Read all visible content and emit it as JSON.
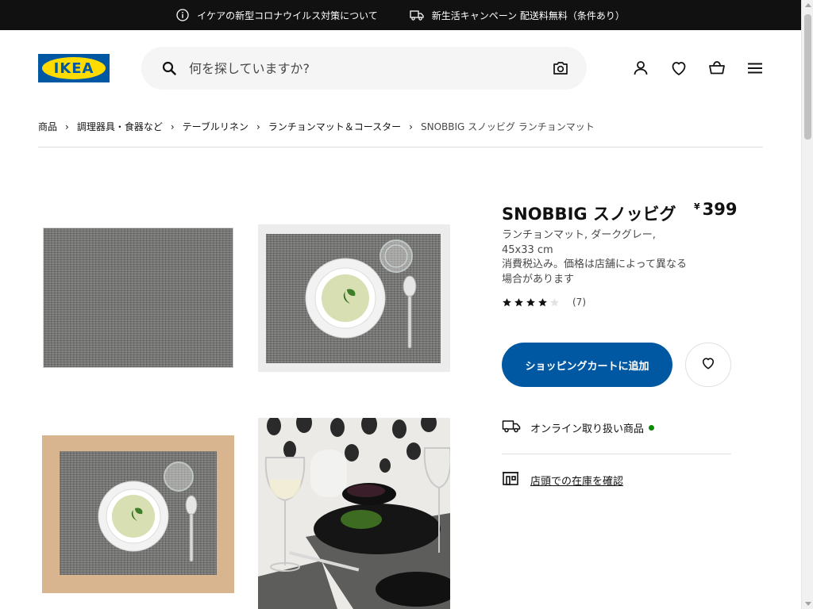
{
  "banner": {
    "covid_notice": "イケアの新型コロナウイルス対策について",
    "delivery_campaign": "新生活キャンペーン 配送料無料（条件あり）"
  },
  "header": {
    "logo_text": "IKEA",
    "search_placeholder": "何を探していますか?",
    "icons": [
      "user-icon",
      "heart-icon",
      "cart-icon",
      "menu-icon"
    ]
  },
  "breadcrumb": {
    "items": [
      "商品",
      "調理器具・食器など",
      "テーブルリネン",
      "ランチョンマット＆コースター",
      "SNOBBIG スノッビグ ランチョンマット"
    ]
  },
  "product": {
    "name": "SNOBBIG スノッビグ",
    "currency": "¥",
    "price": "399",
    "description": "ランチョンマット, ダークグレー, 45x33 cm",
    "tax_note": "消費税込み。価格は店舗によって異なる場合があります",
    "rating": 4,
    "rating_max": 5,
    "review_count": "(7)",
    "add_to_cart_label": "ショッピングカートに追加",
    "online_label": "オンライン取り扱い商品",
    "store_stock_label": "店頭での在庫を確認"
  },
  "colors": {
    "brand_blue": "#0058a3",
    "brand_yellow": "#ffdb00",
    "available_green": "#0a8a00",
    "banner_bg": "#111111"
  }
}
